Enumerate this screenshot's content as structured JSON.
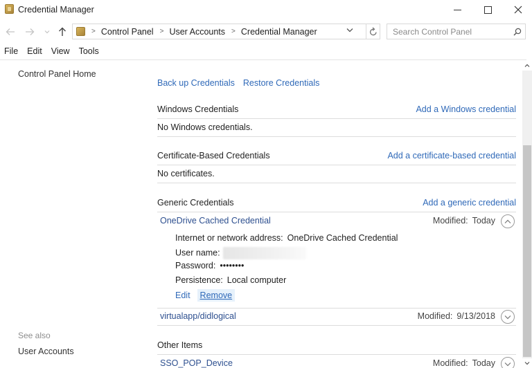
{
  "window": {
    "title": "Credential Manager",
    "controls": {
      "minimize": "minimize",
      "maximize": "maximize",
      "close": "close"
    }
  },
  "nav": {
    "back_icon": "arrow-left-icon",
    "forward_icon": "arrow-right-icon",
    "recent_icon": "chevron-down-icon",
    "up_icon": "arrow-up-icon",
    "breadcrumb": [
      "Control Panel",
      "User Accounts",
      "Credential Manager"
    ],
    "search": {
      "placeholder": "Search Control Panel",
      "value": ""
    }
  },
  "menu": [
    "File",
    "Edit",
    "View",
    "Tools"
  ],
  "sidebar": {
    "home": "Control Panel Home",
    "see_also_label": "See also",
    "see_also_links": [
      "User Accounts"
    ]
  },
  "main": {
    "backup_link": "Back up Credentials",
    "restore_link": "Restore Credentials",
    "sections": {
      "windows": {
        "title": "Windows Credentials",
        "action": "Add a Windows credential",
        "empty": "No Windows credentials."
      },
      "certificate": {
        "title": "Certificate-Based Credentials",
        "action": "Add a certificate-based credential",
        "empty": "No certificates."
      },
      "generic": {
        "title": "Generic Credentials",
        "action": "Add a generic credential",
        "items": [
          {
            "name": "OneDrive Cached Credential",
            "modified_label": "Modified:",
            "modified_value": "Today",
            "expanded": true,
            "details": {
              "address_label": "Internet or network address:",
              "address_value": "OneDrive Cached Credential",
              "username_label": "User name:",
              "username_value": "",
              "password_label": "Password:",
              "password_value": "••••••••",
              "persistence_label": "Persistence:",
              "persistence_value": "Local computer"
            },
            "edit_label": "Edit",
            "remove_label": "Remove"
          },
          {
            "name": "virtualapp/didlogical",
            "modified_label": "Modified:",
            "modified_value": "9/13/2018",
            "expanded": false
          }
        ]
      },
      "other": {
        "title": "Other Items",
        "items": [
          {
            "name": "SSO_POP_Device",
            "modified_label": "Modified:",
            "modified_value": "Today",
            "expanded": false
          }
        ]
      }
    }
  },
  "colors": {
    "link": "#2f69b8",
    "item_name": "#2d4f8f",
    "divider": "#dcdcdc",
    "scroll_thumb": "#c6c6c6"
  }
}
